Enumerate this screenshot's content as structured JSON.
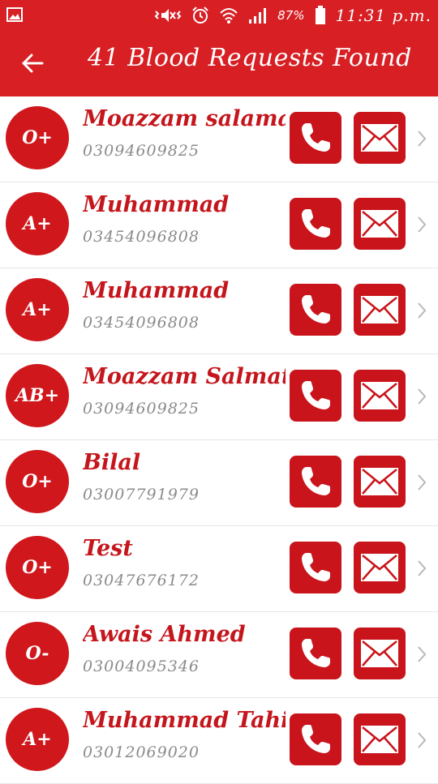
{
  "status_bar": {
    "battery": "87%",
    "time": "11:31 p.m."
  },
  "app_bar": {
    "title": "41 Blood Requests Found"
  },
  "requests": [
    {
      "group": "O+",
      "name": "Moazzam salamat",
      "phone": "03094609825"
    },
    {
      "group": "A+",
      "name": "Muhammad",
      "phone": "03454096808"
    },
    {
      "group": "A+",
      "name": "Muhammad",
      "phone": "03454096808"
    },
    {
      "group": "AB+",
      "name": "Moazzam Salmat",
      "phone": "03094609825"
    },
    {
      "group": "O+",
      "name": "Bilal",
      "phone": "03007791979"
    },
    {
      "group": "O+",
      "name": "Test",
      "phone": "03047676172"
    },
    {
      "group": "O-",
      "name": "Awais Ahmed",
      "phone": "03004095346"
    },
    {
      "group": "A+",
      "name": "Muhammad Tahir",
      "phone": "03012069020"
    }
  ],
  "icons": {
    "call": "phone-icon",
    "mail": "mail-icon",
    "chevron": "chevron-right-icon"
  },
  "colors": {
    "primary": "#d71f24",
    "accent": "#c8141a",
    "phone_text": "#8a8a8a"
  }
}
